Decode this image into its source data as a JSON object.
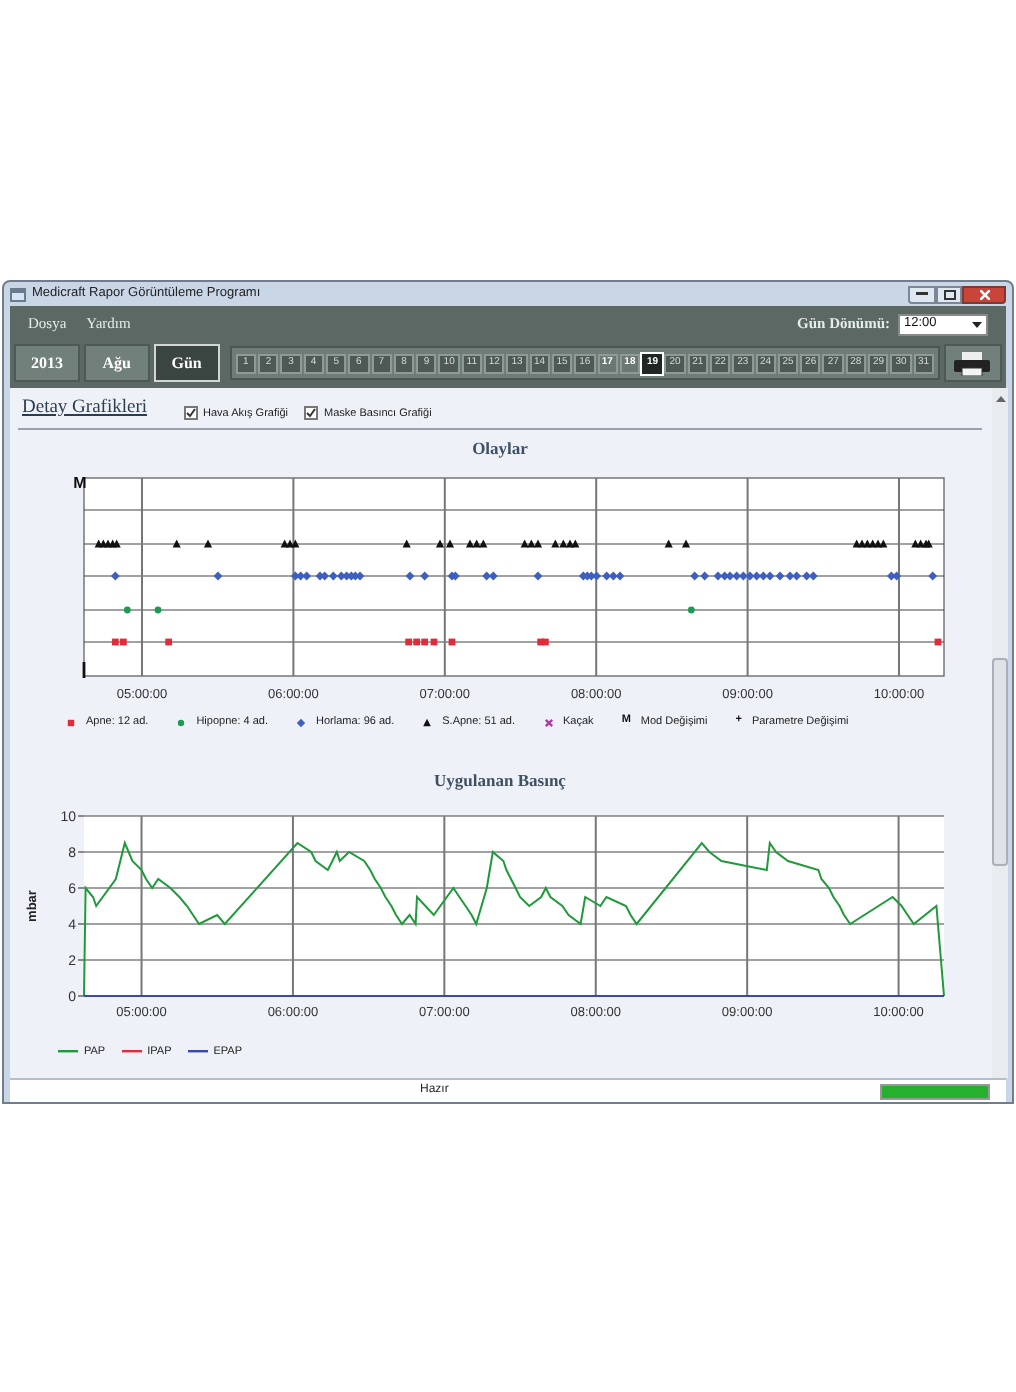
{
  "window": {
    "title": "Medicraft Rapor Görüntüleme Programı"
  },
  "menu": [
    "Dosya",
    "Yardım"
  ],
  "day_turn": {
    "label": "Gün Dönümü:",
    "value": "12:00"
  },
  "period_tabs": [
    {
      "label": "2013",
      "selected": false
    },
    {
      "label": "Ağu",
      "selected": false
    },
    {
      "label": "Gün",
      "selected": true
    }
  ],
  "days": [
    {
      "label": "1",
      "selected": false,
      "disabled": true
    },
    {
      "label": "2",
      "selected": false,
      "disabled": true
    },
    {
      "label": "3",
      "selected": false,
      "disabled": true
    },
    {
      "label": "4",
      "selected": false,
      "disabled": true
    },
    {
      "label": "5",
      "selected": false,
      "disabled": true
    },
    {
      "label": "6",
      "selected": false,
      "disabled": true
    },
    {
      "label": "7",
      "selected": false,
      "disabled": true
    },
    {
      "label": "8",
      "selected": false,
      "disabled": true
    },
    {
      "label": "9",
      "selected": false,
      "disabled": true
    },
    {
      "label": "10",
      "selected": false,
      "disabled": true
    },
    {
      "label": "11",
      "selected": false,
      "disabled": true
    },
    {
      "label": "12",
      "selected": false,
      "disabled": true
    },
    {
      "label": "13",
      "selected": false,
      "disabled": true
    },
    {
      "label": "14",
      "selected": false,
      "disabled": true
    },
    {
      "label": "15",
      "selected": false,
      "disabled": true
    },
    {
      "label": "16",
      "selected": false,
      "disabled": true
    },
    {
      "label": "17",
      "selected": false,
      "disabled": false
    },
    {
      "label": "18",
      "selected": false,
      "disabled": false
    },
    {
      "label": "19",
      "selected": true,
      "disabled": false
    },
    {
      "label": "20",
      "selected": false,
      "disabled": true
    },
    {
      "label": "21",
      "selected": false,
      "disabled": true
    },
    {
      "label": "22",
      "selected": false,
      "disabled": true
    },
    {
      "label": "23",
      "selected": false,
      "disabled": true
    },
    {
      "label": "24",
      "selected": false,
      "disabled": true
    },
    {
      "label": "25",
      "selected": false,
      "disabled": true
    },
    {
      "label": "26",
      "selected": false,
      "disabled": true
    },
    {
      "label": "27",
      "selected": false,
      "disabled": true
    },
    {
      "label": "28",
      "selected": false,
      "disabled": true
    },
    {
      "label": "29",
      "selected": false,
      "disabled": true
    },
    {
      "label": "30",
      "selected": false,
      "disabled": true
    },
    {
      "label": "31",
      "selected": false,
      "disabled": true
    }
  ],
  "detail": {
    "title": "Detay Grafikleri",
    "options": [
      {
        "label": "Hava Akış Grafiği",
        "checked": true
      },
      {
        "label": "Maske Basıncı Grafiği",
        "checked": true
      }
    ]
  },
  "events_chart": {
    "title": "Olaylar",
    "mode_marker": "M",
    "xtick_labels": [
      "05:00:00",
      "06:00:00",
      "07:00:00",
      "08:00:00",
      "09:00:00",
      "10:00:00"
    ],
    "legend": [
      {
        "label": "Apne: 12 ad.",
        "kind": "square",
        "color": "#e02b3a"
      },
      {
        "label": "Hipopne: 4 ad.",
        "kind": "circle",
        "color": "#1f9a55"
      },
      {
        "label": "Horlama: 96 ad.",
        "kind": "diamond",
        "color": "#3f5fbf"
      },
      {
        "label": "S.Apne: 51 ad.",
        "kind": "triangle",
        "color": "#111111"
      },
      {
        "label": "Kaçak",
        "kind": "cross",
        "color": "#b23aa8"
      },
      {
        "label": "Mod Değişimi",
        "kind": "char",
        "marker": "M",
        "color": "#111111"
      },
      {
        "label": "Parametre Değişimi",
        "kind": "char",
        "marker": "+",
        "color": "#111111"
      }
    ]
  },
  "pressure_chart": {
    "chart_data": {
      "type": "line",
      "title": "Uygulanan Basınç",
      "ylabel": "mbar",
      "x": [
        4.62,
        4.63,
        4.68,
        4.7,
        4.83,
        4.89,
        4.94,
        5.0,
        5.03,
        5.07,
        5.11,
        5.19,
        5.25,
        5.3,
        5.34,
        5.38,
        5.5,
        5.55,
        6.03,
        6.12,
        6.15,
        6.23,
        6.26,
        6.29,
        6.31,
        6.37,
        6.47,
        6.51,
        6.54,
        6.58,
        6.61,
        6.65,
        6.68,
        6.72,
        6.77,
        6.81,
        6.82,
        6.93,
        7.06,
        7.1,
        7.14,
        7.18,
        7.21,
        7.28,
        7.32,
        7.39,
        7.41,
        7.44,
        7.47,
        7.5,
        7.56,
        7.64,
        7.67,
        7.7,
        7.78,
        7.82,
        7.9,
        7.93,
        8.03,
        8.07,
        8.2,
        8.23,
        8.27,
        8.7,
        8.75,
        8.83,
        9.13,
        9.15,
        9.19,
        9.27,
        9.47,
        9.49,
        9.54,
        9.57,
        9.61,
        9.64,
        9.68,
        9.96,
        10.02,
        10.06,
        10.1,
        10.25,
        10.3
      ],
      "series": [
        {
          "name": "PAP",
          "color": "#1f9a3a",
          "values": [
            0,
            6,
            5.5,
            5,
            6.5,
            8.5,
            7.5,
            7,
            6.5,
            6,
            6.5,
            6,
            5.5,
            5,
            4.5,
            4,
            4.5,
            4,
            8.5,
            8,
            7.5,
            7,
            7.5,
            8,
            7.5,
            8,
            7.5,
            7,
            6.5,
            6,
            5.5,
            5,
            4.5,
            4,
            4.5,
            4,
            5.5,
            4.5,
            6,
            5.5,
            5,
            4.5,
            4,
            6,
            8,
            7.5,
            7,
            6.5,
            6,
            5.5,
            5,
            5.5,
            6,
            5.5,
            5,
            4.5,
            4,
            5.5,
            5,
            5.5,
            5,
            4.5,
            4,
            8.5,
            8,
            7.5,
            7,
            8.5,
            8,
            7.5,
            7,
            6.5,
            6,
            5.5,
            5,
            4.5,
            4,
            5.5,
            5,
            4.5,
            4,
            5,
            0
          ]
        },
        {
          "name": "IPAP",
          "color": "#e02b3a",
          "values": [
            null,
            null,
            null,
            null,
            null,
            null,
            null,
            null,
            null,
            null,
            null,
            null,
            null,
            null,
            null,
            null,
            null,
            null,
            null,
            null,
            null,
            null,
            null,
            null,
            null,
            null,
            null,
            null,
            null,
            null,
            null,
            null,
            null,
            null,
            null,
            null,
            null,
            null,
            null,
            null,
            null,
            null,
            null,
            null,
            null,
            null,
            null,
            null,
            null,
            null,
            null,
            null,
            null,
            null,
            null,
            null,
            null,
            null,
            null,
            null,
            null,
            null,
            null,
            null,
            null,
            null,
            null,
            null,
            null,
            null,
            null,
            null,
            null,
            null,
            null,
            null,
            null,
            null,
            null,
            null,
            null,
            null,
            null
          ]
        },
        {
          "name": "EPAP",
          "color": "#3b4aa8",
          "values": [
            0,
            0,
            0,
            0,
            0,
            0,
            0,
            0,
            0,
            0,
            0,
            0,
            0,
            0,
            0,
            0,
            0,
            0,
            0,
            0,
            0,
            0,
            0,
            0,
            0,
            0,
            0,
            0,
            0,
            0,
            0,
            0,
            0,
            0,
            0,
            0,
            0,
            0,
            0,
            0,
            0,
            0,
            0,
            0,
            0,
            0,
            0,
            0,
            0,
            0,
            0,
            0,
            0,
            0,
            0,
            0,
            0,
            0,
            0,
            0,
            0,
            0,
            0,
            0,
            0,
            0,
            0,
            0,
            0,
            0,
            0,
            0,
            0,
            0,
            0,
            0,
            0,
            0,
            0,
            0,
            0,
            0,
            0
          ]
        }
      ],
      "xlim": [
        4.62,
        10.3
      ],
      "ylim": [
        0,
        10
      ],
      "grid": true,
      "xticks": [
        {
          "value": 5,
          "label": "05:00:00"
        },
        {
          "value": 6,
          "label": "06:00:00"
        },
        {
          "value": 7,
          "label": "07:00:00"
        },
        {
          "value": 8,
          "label": "08:00:00"
        },
        {
          "value": 9,
          "label": "09:00:00"
        },
        {
          "value": 10,
          "label": "10:00:00"
        }
      ],
      "yticks": [
        0,
        2,
        4,
        6,
        8,
        10
      ]
    }
  },
  "status_bar": {
    "text": "Hazır",
    "level": 1
  }
}
